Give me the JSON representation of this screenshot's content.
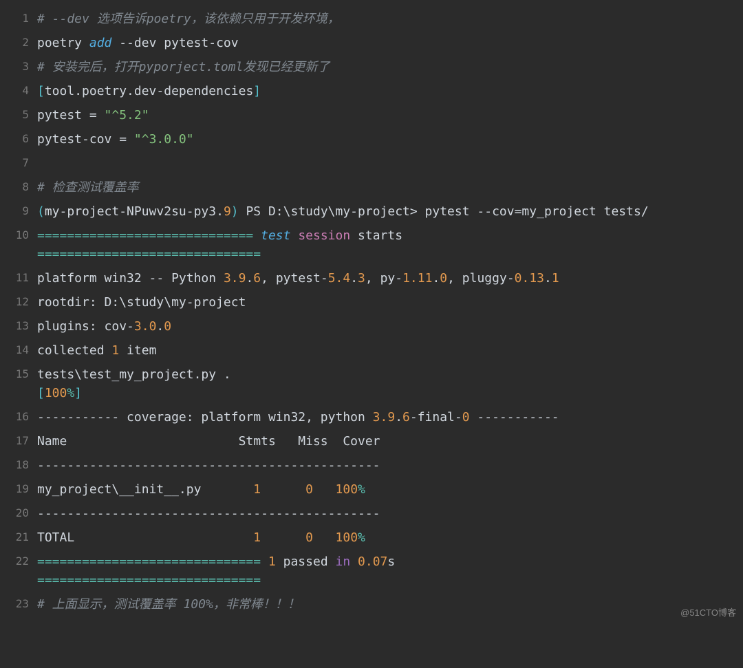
{
  "watermark": "@51CTO博客",
  "lines": [
    {
      "n": "1",
      "html": "<span class='c'># --dev 选项告诉poetry，该依赖只用于开发环境，</span>"
    },
    {
      "n": "2",
      "html": "<span class='pl'>poetry </span><span class='fn'>add</span><span class='pl'> </span><span class='pl'>--dev pytest-cov</span>"
    },
    {
      "n": "3",
      "html": "<span class='c'># 安装完后，打开pyporject.toml发现已经更新了</span>"
    },
    {
      "n": "4",
      "html": "<span class='bn'>[</span><span class='pl'>tool.poetry.dev-dependencies</span><span class='bn'>]</span>"
    },
    {
      "n": "5",
      "html": "<span class='pl'>pytest = </span><span class='st'>\"^5.2\"</span>"
    },
    {
      "n": "6",
      "html": "<span class='pl'>pytest-cov = </span><span class='st'>\"^3.0.0\"</span>"
    },
    {
      "n": "7",
      "html": ""
    },
    {
      "n": "8",
      "html": "<span class='c'># 检查测试覆盖率</span>"
    },
    {
      "n": "9",
      "html": "<span class='bn'>(</span><span class='pl'>my-project-NPuwv2su-py3.</span><span class='nm'>9</span><span class='bn'>)</span><span class='pl'> PS D:\\study\\my-project&gt; pytest --cov=my_project tests/</span>"
    },
    {
      "n": "10",
      "html": "<span class='gr'>=============================</span><span class='pl'> </span><span class='fn'>test</span><span class='pl'> </span><span class='mg'>session</span><span class='pl'> starts </span><br><span class='gr'>==============================</span>"
    },
    {
      "n": "11",
      "html": "<span class='pl'>platform win32 -- Python </span><span class='nm'>3.9</span><span class='pl'>.</span><span class='nm'>6</span><span class='pl'>, pytest-</span><span class='nm'>5.4</span><span class='pl'>.</span><span class='nm'>3</span><span class='pl'>, py-</span><span class='nm'>1.11</span><span class='pl'>.</span><span class='nm'>0</span><span class='pl'>, pluggy-</span><span class='nm'>0.13</span><span class='pl'>.</span><span class='nm'>1</span>"
    },
    {
      "n": "12",
      "html": "<span class='pl'>rootdir: D:\\study\\my-project</span>"
    },
    {
      "n": "13",
      "html": "<span class='pl'>plugins: cov-</span><span class='nm'>3.0</span><span class='pl'>.</span><span class='nm'>0</span>"
    },
    {
      "n": "14",
      "html": "<span class='pl'>collected </span><span class='nm'>1</span><span class='pl'> item</span>"
    },
    {
      "n": "15",
      "html": "<span class='pl'>tests\\test_my_project.py .                                                                                                                                                                                    </span><br><span class='bn'>[</span><span class='nm'>100</span><span class='gr'>%</span><span class='bn'>]</span>"
    },
    {
      "n": "16",
      "html": "<span class='pl'>----------- coverage: platform win32, python </span><span class='nm'>3.9</span><span class='pl'>.</span><span class='nm'>6</span><span class='pl'>-final-</span><span class='nm'>0</span><span class='pl'> -----------</span>"
    },
    {
      "n": "17",
      "html": "<span class='pl'>Name                       Stmts   Miss  Cover</span>"
    },
    {
      "n": "18",
      "html": "<span class='pl'>----------------------------------------------</span>"
    },
    {
      "n": "19",
      "html": "<span class='pl'>my_project\\__init__.py       </span><span class='nm'>1</span><span class='pl'>      </span><span class='nm'>0</span><span class='pl'>   </span><span class='nm'>100</span><span class='gr'>%</span>"
    },
    {
      "n": "20",
      "html": "<span class='pl'>----------------------------------------------</span>"
    },
    {
      "n": "21",
      "html": "<span class='pl'>TOTAL                        </span><span class='nm'>1</span><span class='pl'>      </span><span class='nm'>0</span><span class='pl'>   </span><span class='nm'>100</span><span class='gr'>%</span>"
    },
    {
      "n": "22",
      "html": "<span class='gr'>==============================</span><span class='pl'> </span><span class='nm'>1</span><span class='pl'> passed </span><span class='kw'>in</span><span class='pl'> </span><span class='nm'>0.07</span><span class='pl'>s </span><br><span class='gr'>==============================</span>"
    },
    {
      "n": "23",
      "html": "<span class='c'># 上面显示，测试覆盖率 100%，非常棒！！！</span>"
    }
  ]
}
